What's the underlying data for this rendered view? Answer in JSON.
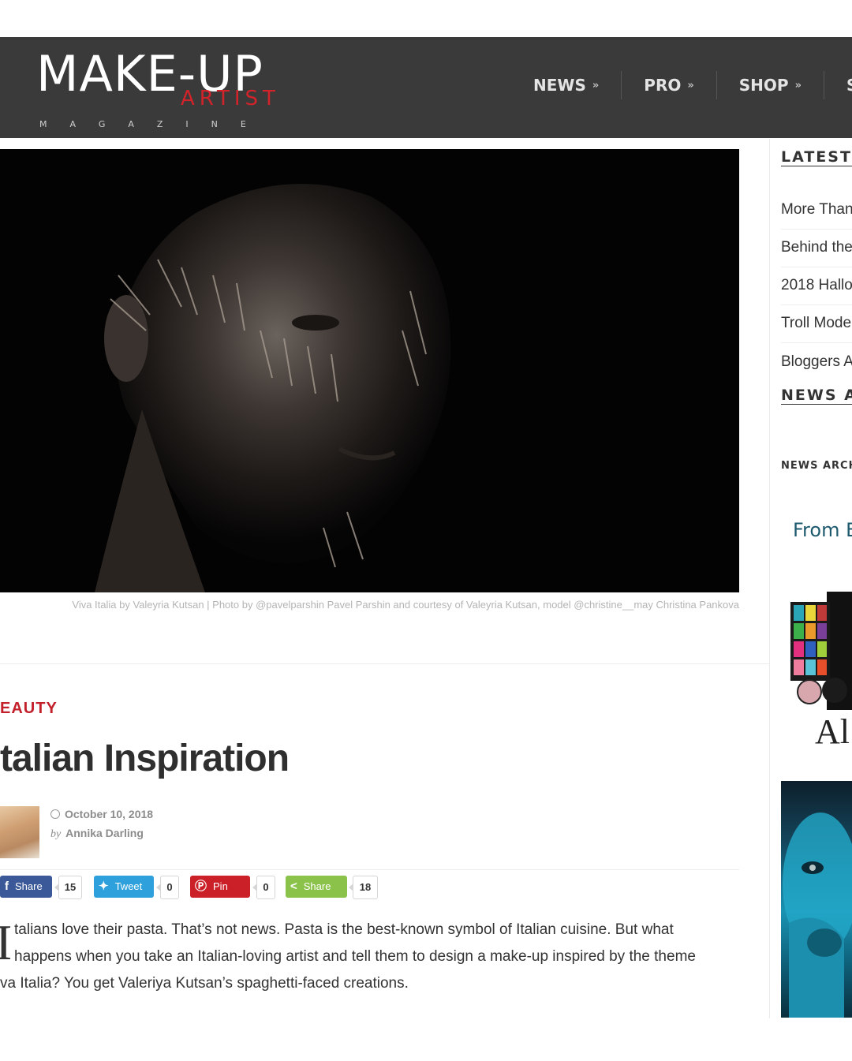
{
  "header": {
    "logo": {
      "main": "MAKE-UP",
      "artist": "ARTIST",
      "magazine": "MAGAZINE"
    },
    "nav": [
      {
        "label": "NEWS",
        "icon": "chevron-double-down-icon"
      },
      {
        "label": "PRO",
        "icon": "chevron-double-down-icon"
      },
      {
        "label": "SHOP",
        "icon": "chevron-double-down-icon"
      },
      {
        "label": "SC",
        "icon": ""
      }
    ]
  },
  "hero": {
    "caption": "Viva Italia by Valeyria Kutsan | Photo by @pavelparshin Pavel Parshin and courtesy of Valeyria Kutsan, model @christine__may Christina Pankova"
  },
  "article": {
    "category": "EAUTY",
    "title": "talian Inspiration",
    "date": "October 10, 2018",
    "author_prefix": "by",
    "author": "Annika Darling",
    "share": [
      {
        "label": "Share",
        "count": "15",
        "color": "#3b5998",
        "icon": "facebook-icon"
      },
      {
        "label": "Tweet",
        "count": "0",
        "color": "#2ea1dc",
        "icon": "twitter-icon"
      },
      {
        "label": "Pin",
        "count": "0",
        "color": "#cb2027",
        "icon": "pinterest-icon"
      },
      {
        "label": "Share",
        "count": "18",
        "color": "#8bc34a",
        "icon": "share-icon"
      }
    ],
    "dropcap": "I",
    "lines": [
      "talians love their pasta. That’s not news. Pasta is the best-known symbol of Italian cuisine. But what",
      "happens when you take an Italian-loving artist and tell them to design a make-up inspired by the theme",
      "va Italia? You get Valeriya Kutsan’s spaghetti-faced creations."
    ]
  },
  "sidebar": {
    "latest_heading": "LATEST",
    "latest_items": [
      "More Than",
      "Behind the",
      "2018 Hallo",
      "Troll Mode",
      "Bloggers A"
    ],
    "news_heading": "NEWS AI",
    "archive_heading": "NEWS ARCHI",
    "from_label": "From E",
    "ad_word": "Al"
  }
}
